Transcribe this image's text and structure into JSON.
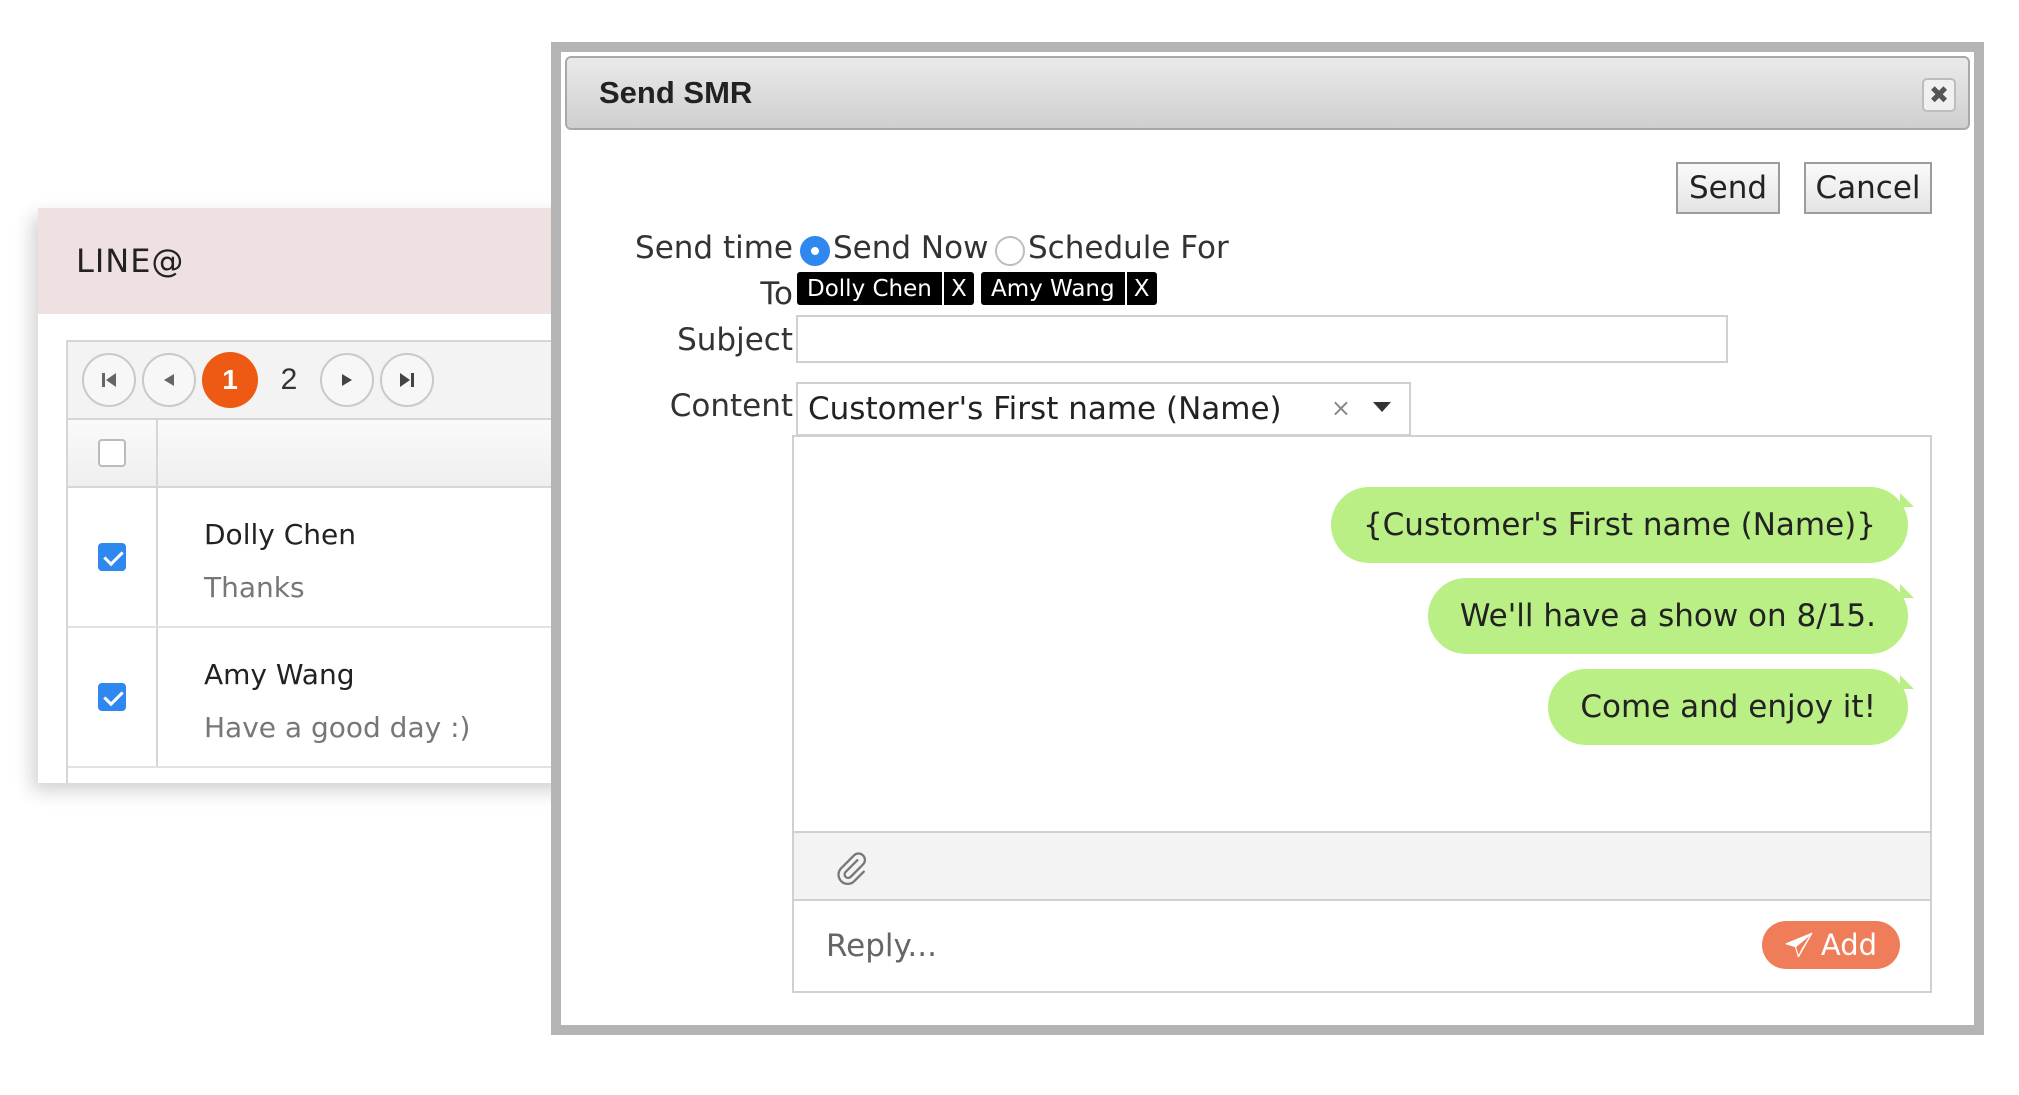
{
  "line_panel": {
    "title": "LINE@",
    "pager": {
      "current": "1",
      "next": "2"
    },
    "rows": [
      {
        "name": "Dolly Chen",
        "message": "Thanks",
        "checked": true
      },
      {
        "name": "Amy Wang",
        "message": "Have a good day :)",
        "checked": true
      }
    ]
  },
  "modal": {
    "title": "Send SMR",
    "close": "✖",
    "buttons": {
      "send": "Send",
      "cancel": "Cancel"
    },
    "send_time": {
      "label": "Send time",
      "option_now": "Send Now",
      "option_schedule": "Schedule For",
      "selected": "Send Now"
    },
    "to": {
      "label": "To",
      "recipients": [
        {
          "name": "Dolly Chen",
          "remove": "X"
        },
        {
          "name": "Amy Wang",
          "remove": "X"
        }
      ]
    },
    "subject": {
      "label": "Subject",
      "value": ""
    },
    "content": {
      "label": "Content",
      "selected": "Customer's First name (Name)",
      "clear": "×"
    },
    "messages": [
      "{Customer's First name (Name)}",
      "We'll have a show on 8/15.",
      "Come and enjoy it!"
    ],
    "attach_icon": "paperclip-icon",
    "reply": {
      "placeholder": "Reply...",
      "add_label": "Add",
      "add_icon": "paper-plane-icon"
    }
  },
  "colors": {
    "accent_orange": "#ee5a14",
    "add_button": "#f07d5a",
    "bubble_green": "#b9ef84",
    "check_blue": "#2e88f0",
    "line_header": "#efe1e1"
  }
}
